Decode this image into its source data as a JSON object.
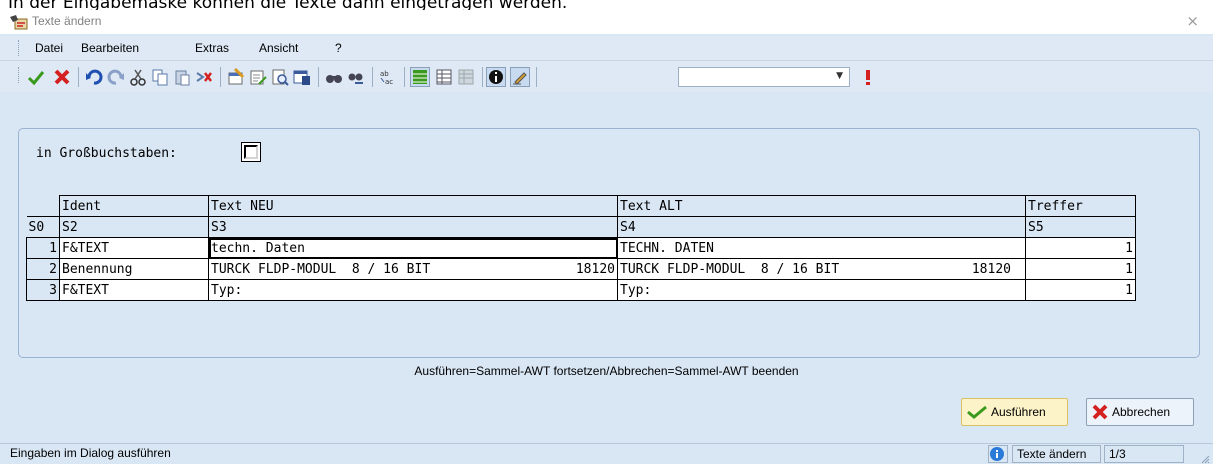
{
  "document": {
    "intro_text": "In der Eingabemaske können die Texte dann eingetragen werden."
  },
  "window": {
    "title": "Texte ändern",
    "close_label": "×"
  },
  "menu": {
    "items": [
      "Datei",
      "Bearbeiten",
      "Extras",
      "Ansicht",
      "?"
    ]
  },
  "toolbar": {
    "icons": [
      "check-icon",
      "cancel-icon",
      "undo-icon",
      "redo-icon",
      "cut-icon",
      "copy-icon",
      "paste-icon",
      "delete-icon",
      "properties-icon",
      "edit-document-icon",
      "preview-icon",
      "save-window-icon",
      "find-icon",
      "find-next-icon",
      "replace-text-icon",
      "grid-view-icon",
      "table-view-icon",
      "table-gray-icon",
      "info-icon",
      "pen-icon",
      "alert-icon"
    ],
    "combo_value": ""
  },
  "form": {
    "uppercase_label": "in Großbuchstaben:",
    "uppercase_checked": false
  },
  "grid": {
    "headers": [
      "",
      "Ident",
      "Text NEU",
      "Text ALT",
      "Treffer"
    ],
    "code_row": [
      "S0",
      "S2",
      "S3",
      "S4",
      "S5"
    ],
    "rows": [
      {
        "n": "1",
        "ident": "F&TEXT",
        "neu": "techn. Daten",
        "neu_num": "",
        "alt": "TECHN. DATEN",
        "alt_num": "",
        "treffer": "1"
      },
      {
        "n": "2",
        "ident": "Benennung",
        "neu": "TURCK FLDP-MODUL  8 / 16 BIT",
        "neu_num": "18120",
        "alt": "TURCK FLDP-MODUL  8 / 16 BIT",
        "alt_num": "18120",
        "treffer": "1"
      },
      {
        "n": "3",
        "ident": "F&TEXT",
        "neu": "Typ:",
        "neu_num": "",
        "alt": "Typ:",
        "alt_num": "",
        "treffer": "1"
      }
    ]
  },
  "info": {
    "text": "Ausführen=Sammel-AWT fortsetzen/Abbrechen=Sammel-AWT beenden"
  },
  "buttons": {
    "execute": "Ausführen",
    "cancel": "Abbrechen"
  },
  "status": {
    "message": "Eingaben im Dialog ausführen",
    "dialog_name": "Texte ändern",
    "page": "1/3"
  },
  "colors": {
    "window_bg": "#d9e6f4",
    "primary_button": "#fcf4c8",
    "accent_green": "#3a9a1e",
    "accent_red": "#d42020"
  }
}
